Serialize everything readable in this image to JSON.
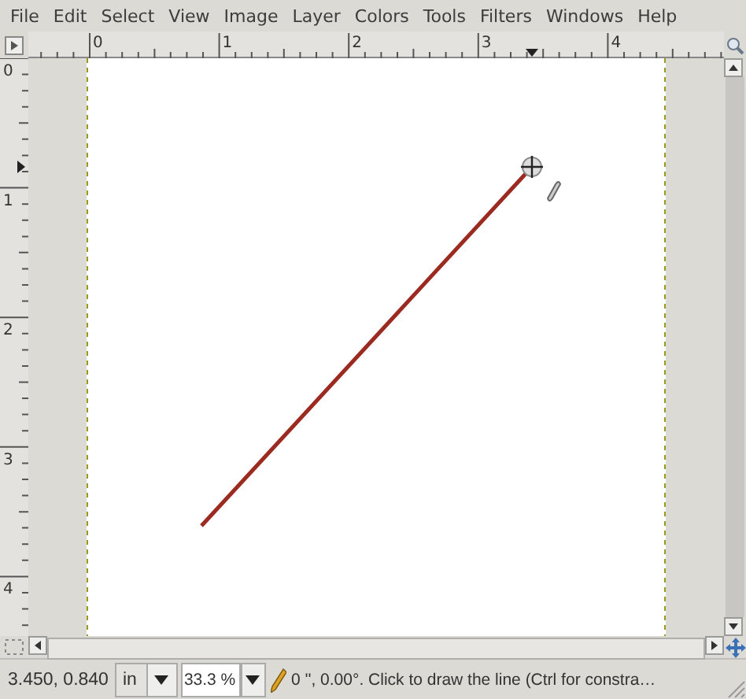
{
  "menu": [
    "File",
    "Edit",
    "Select",
    "View",
    "Image",
    "Layer",
    "Colors",
    "Tools",
    "Filters",
    "Windows",
    "Help"
  ],
  "rulers": {
    "horizontal": [
      "0",
      "1",
      "2",
      "3",
      "4"
    ],
    "vertical": [
      "0",
      "1",
      "2",
      "3",
      "4"
    ]
  },
  "status_bar": {
    "pointer": "3.450, 0.840",
    "unit": "in",
    "zoom": "33.3 %",
    "message": "0 '', 0.00°. Click to draw the line (Ctrl for constra…"
  }
}
